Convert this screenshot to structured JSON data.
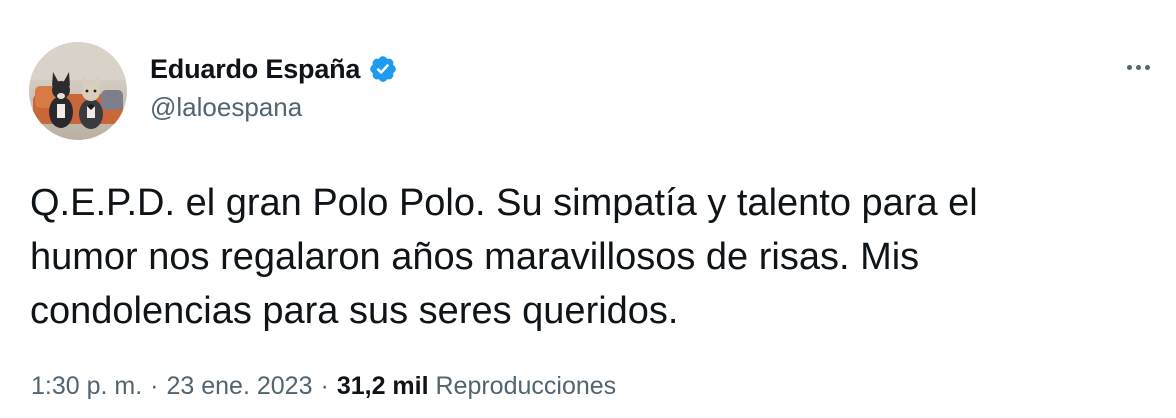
{
  "author": {
    "display_name": "Eduardo España",
    "handle": "@laloespana",
    "verified": true
  },
  "tweet": {
    "text_lines": [
      "Q.E.P.D. el gran Polo Polo. Su simpatía y talento para el",
      "humor nos regalaron años maravillosos de risas. Mis",
      "condolencias para sus seres queridos."
    ]
  },
  "meta": {
    "time": "1:30 p. m.",
    "separator": "·",
    "date": "23 ene. 2023",
    "views_count": "31,2 mil",
    "views_label": "Reproducciones"
  },
  "icons": {
    "verified": "verified-badge-icon",
    "more": "more-options-icon"
  },
  "colors": {
    "verified_blue": "#1d9bf0",
    "secondary_text": "#536471",
    "primary_text": "#0f1419"
  }
}
